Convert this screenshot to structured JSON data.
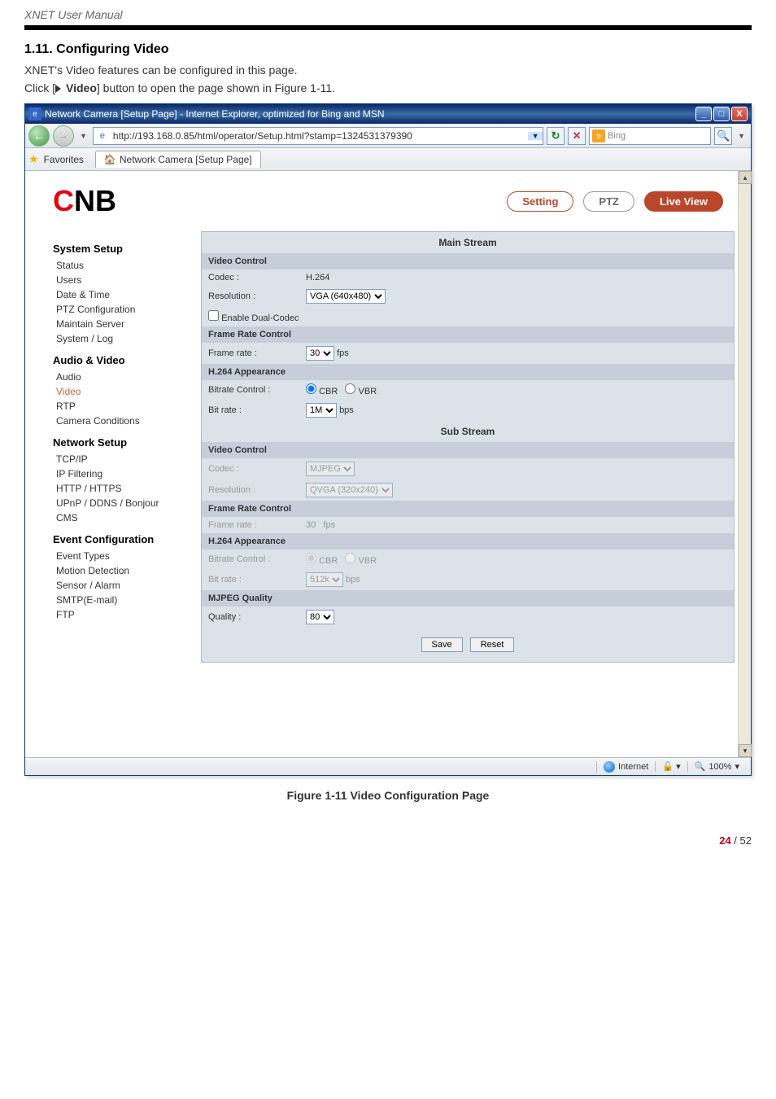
{
  "doc_header": "XNET User Manual",
  "section": {
    "title": "1.11. Configuring Video",
    "line1": "XNET's Video features can be configured in this page.",
    "line2_pre": "Click [",
    "line2_bold": "Video",
    "line2_post": "] button to open the page shown in Figure 1-11."
  },
  "window": {
    "title": "Network Camera [Setup Page] - Internet Explorer, optimized for Bing and MSN",
    "address": "http://193.168.0.85/html/operator/Setup.html?stamp=1324531379390",
    "search_placeholder": "Bing",
    "fav_label": "Favorites",
    "tab_label": "Network Camera [Setup Page]"
  },
  "page": {
    "top_buttons": {
      "setting": "Setting",
      "ptz": "PTZ",
      "live": "Live View"
    },
    "sidebar": {
      "group1": "System Setup",
      "items1": [
        "Status",
        "Users",
        "Date & Time",
        "PTZ Configuration",
        "Maintain Server",
        "System / Log"
      ],
      "group2": "Audio & Video",
      "items2": [
        "Audio",
        "Video",
        "RTP",
        "Camera Conditions"
      ],
      "group3": "Network Setup",
      "items3": [
        "TCP/IP",
        "IP Filtering",
        "HTTP / HTTPS",
        "UPnP / DDNS / Bonjour",
        "CMS"
      ],
      "group4": "Event Configuration",
      "items4": [
        "Event Types",
        "Motion Detection",
        "Sensor / Alarm",
        "SMTP(E-mail)",
        "FTP"
      ]
    },
    "main": {
      "main_stream": "Main Stream",
      "sub_stream": "Sub Stream",
      "video_control": "Video Control",
      "codec_label": "Codec :",
      "codec_value_main": "H.264",
      "resolution_label": "Resolution :",
      "resolution_value_main": "VGA (640x480)",
      "enable_dual": "Enable Dual-Codec",
      "frame_rate_control": "Frame Rate Control",
      "frame_rate_label": "Frame rate :",
      "frame_rate_main": "30",
      "fps": "fps",
      "h264_appearance": "H.264 Appearance",
      "bitrate_control": "Bitrate Control :",
      "cbr": "CBR",
      "vbr": "VBR",
      "bitrate_label": "Bit rate :",
      "bitrate_main": "1M",
      "bitrate_sub": "512k",
      "bps": "bps",
      "codec_value_sub": "MJPEG",
      "resolution_value_sub": "QVGA (320x240)",
      "frame_rate_sub": "30",
      "mjpeg_quality": "MJPEG Quality",
      "quality_label": "Quality :",
      "quality_value": "80",
      "save": "Save",
      "reset": "Reset"
    }
  },
  "statusbar": {
    "zone": "Internet",
    "zoom": "100%"
  },
  "caption": "Figure 1-11 Video Configuration Page",
  "page_number": {
    "cur": "24",
    "sep": " / ",
    "total": "52"
  }
}
